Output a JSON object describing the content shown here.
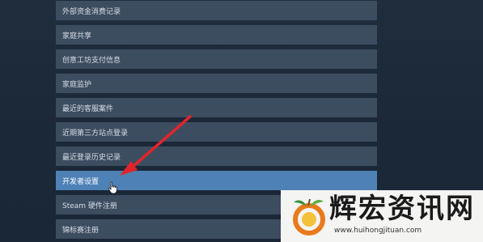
{
  "menu": {
    "items": [
      {
        "label": "外部资金消费记录"
      },
      {
        "label": "家庭共享"
      },
      {
        "label": "创意工坊支付信息"
      },
      {
        "label": "家庭监护"
      },
      {
        "label": "最近的客服案件"
      },
      {
        "label": "近期第三方站点登录"
      },
      {
        "label": "最近登录历史记录"
      },
      {
        "label": "开发者设置",
        "state": "highlighted"
      },
      {
        "label": "Steam 硬件注册"
      },
      {
        "label": "锦标赛注册"
      }
    ]
  },
  "annotation": {
    "arrow_color": "#e0252a"
  },
  "watermark": {
    "title": "辉宏资讯网",
    "url": "www.huihongjituan.com"
  },
  "colors": {
    "row_bg": "#3d4d60",
    "row_active_bg": "#4e82b6",
    "page_bg": "#1b2838"
  }
}
